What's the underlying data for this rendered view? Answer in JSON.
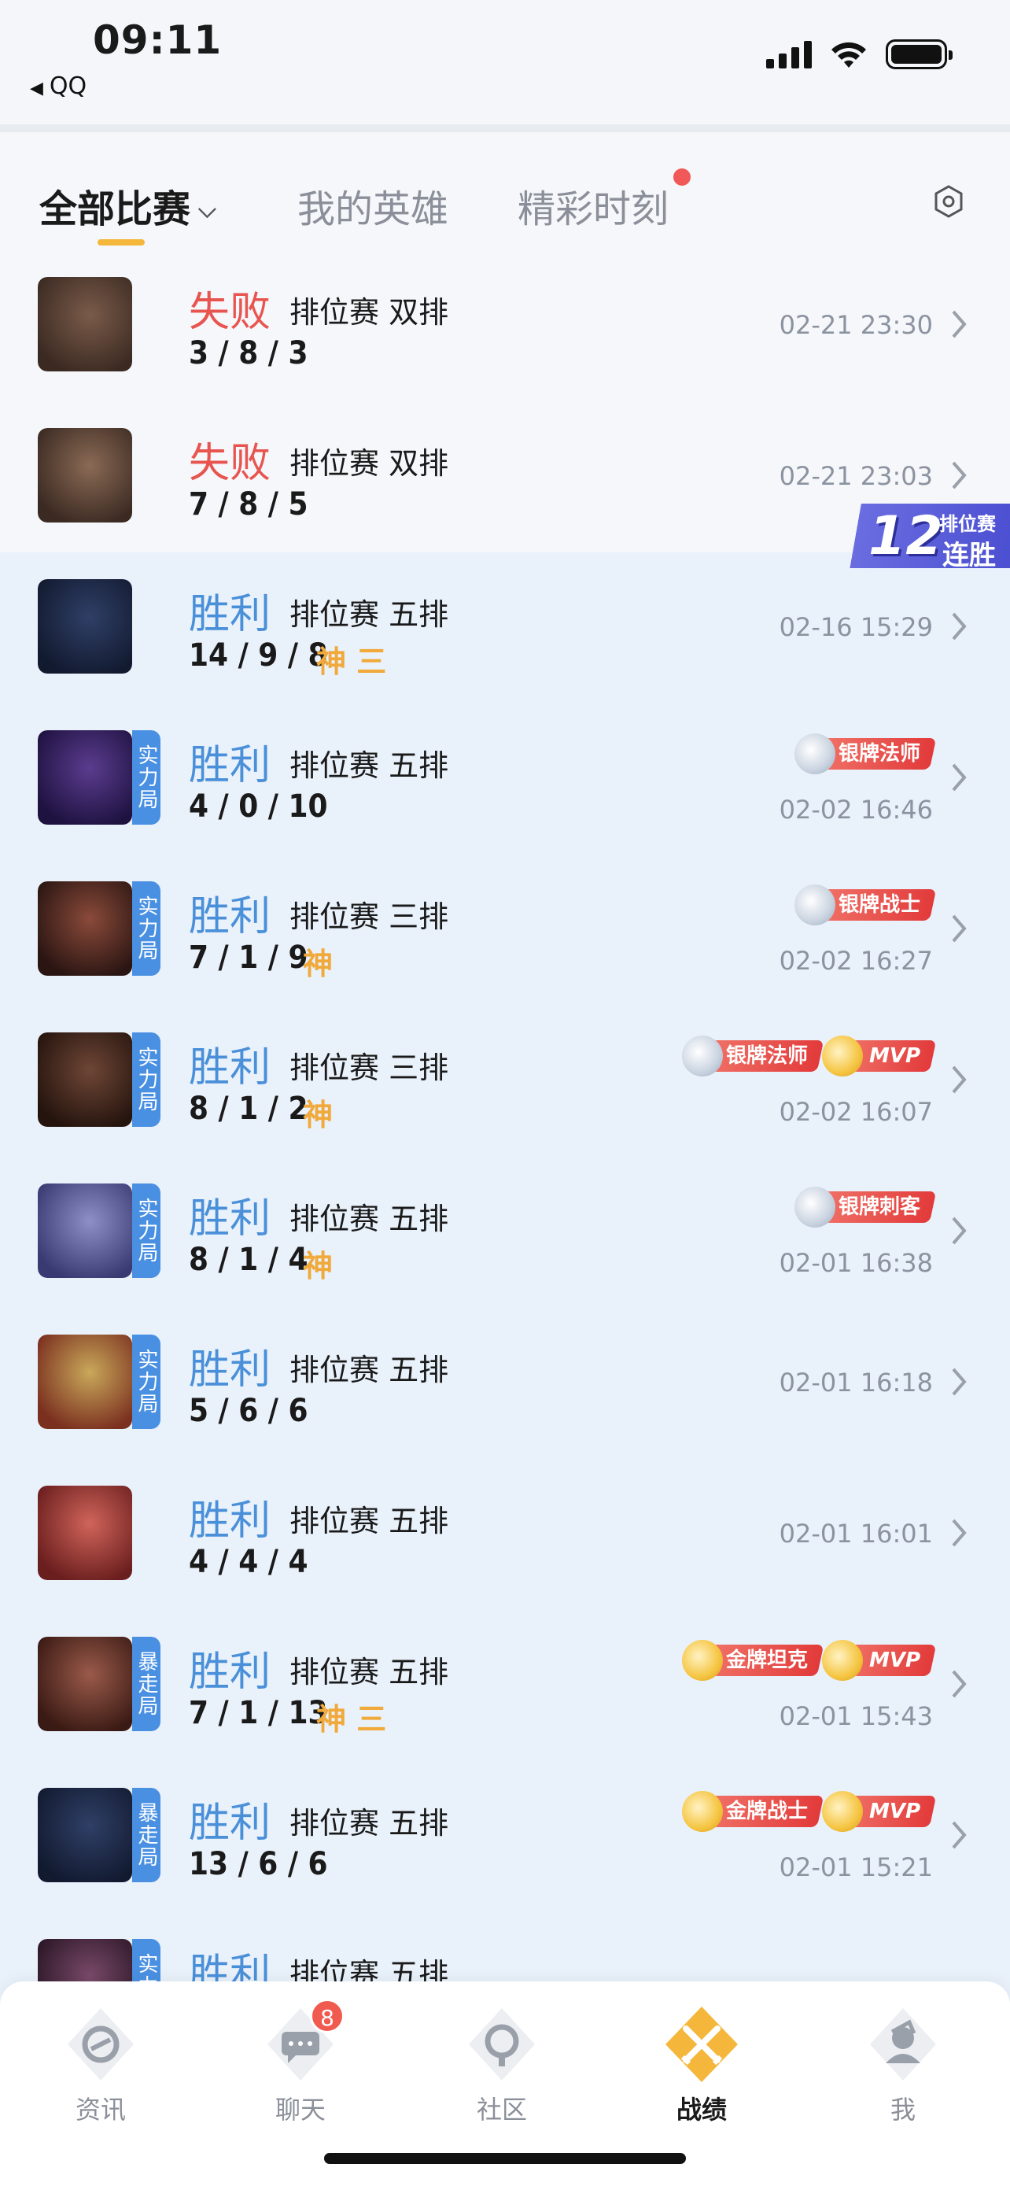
{
  "status_bar": {
    "time": "09:11",
    "back_app": "QQ"
  },
  "tabs": [
    {
      "label": "全部比赛",
      "active": true
    },
    {
      "label": "我的英雄",
      "active": false
    },
    {
      "label": "精彩时刻",
      "active": false,
      "has_dot": true
    }
  ],
  "streak_banner": {
    "number": "12",
    "label_top": "排位赛",
    "label_bottom": "连胜"
  },
  "matches": [
    {
      "result": "失败",
      "mode": "排位赛 双排",
      "kda": "3 / 8 / 3",
      "tags": "",
      "date": "02-21 23:30",
      "badge": "",
      "medals": []
    },
    {
      "result": "失败",
      "mode": "排位赛 双排",
      "kda": "7 / 8 / 5",
      "tags": "",
      "date": "02-21 23:03",
      "badge": "",
      "medals": []
    },
    {
      "result": "胜利",
      "mode": "排位赛 五排",
      "kda": "14 / 9 / 8",
      "tags": "神 三",
      "date": "02-16 15:29",
      "badge": "",
      "medals": []
    },
    {
      "result": "胜利",
      "mode": "排位赛 五排",
      "kda": "4 / 0 / 10",
      "tags": "",
      "date": "02-02 16:46",
      "badge": "实力局",
      "medals": [
        "银牌法师"
      ]
    },
    {
      "result": "胜利",
      "mode": "排位赛 三排",
      "kda": "7 / 1 / 9",
      "tags": "神",
      "date": "02-02 16:27",
      "badge": "实力局",
      "medals": [
        "银牌战士"
      ]
    },
    {
      "result": "胜利",
      "mode": "排位赛 三排",
      "kda": "8 / 1 / 2",
      "tags": "神",
      "date": "02-02 16:07",
      "badge": "实力局",
      "medals": [
        "银牌法师",
        "MVP"
      ]
    },
    {
      "result": "胜利",
      "mode": "排位赛 五排",
      "kda": "8 / 1 / 4",
      "tags": "神",
      "date": "02-01 16:38",
      "badge": "实力局",
      "medals": [
        "银牌刺客"
      ]
    },
    {
      "result": "胜利",
      "mode": "排位赛 五排",
      "kda": "5 / 6 / 6",
      "tags": "",
      "date": "02-01 16:18",
      "badge": "实力局",
      "medals": []
    },
    {
      "result": "胜利",
      "mode": "排位赛 五排",
      "kda": "4 / 4 / 4",
      "tags": "",
      "date": "02-01 16:01",
      "badge": "",
      "medals": []
    },
    {
      "result": "胜利",
      "mode": "排位赛 五排",
      "kda": "7 / 1 / 13",
      "tags": "神 三",
      "date": "02-01 15:43",
      "badge": "暴走局",
      "medals": [
        "金牌坦克",
        "MVP"
      ]
    },
    {
      "result": "胜利",
      "mode": "排位赛 五排",
      "kda": "13 / 6 / 6",
      "tags": "",
      "date": "02-01 15:21",
      "badge": "暴走局",
      "medals": [
        "金牌战士",
        "MVP"
      ]
    },
    {
      "result": "胜利",
      "mode": "排位赛 五排",
      "kda": "",
      "tags": "",
      "date": "",
      "badge": "实力局",
      "medals": []
    }
  ],
  "bottom_nav": [
    {
      "label": "资讯",
      "icon": "news-icon"
    },
    {
      "label": "聊天",
      "icon": "chat-icon",
      "badge": "8"
    },
    {
      "label": "社区",
      "icon": "community-icon"
    },
    {
      "label": "战绩",
      "icon": "battle-record-icon",
      "active": true
    },
    {
      "label": "我",
      "icon": "profile-icon"
    }
  ],
  "colors": {
    "loss": "#e8544f",
    "win": "#4a90d9",
    "accent": "#f5b73b",
    "win_bg": "#e9f1fb"
  }
}
